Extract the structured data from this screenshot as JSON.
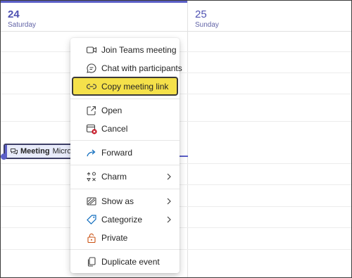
{
  "calendar": {
    "days": [
      {
        "number": "24",
        "name": "Saturday"
      },
      {
        "number": "25",
        "name": "Sunday"
      }
    ],
    "event": {
      "title": "Meeting",
      "organizer": "Microsof"
    }
  },
  "context_menu": {
    "items": [
      {
        "id": "join",
        "label": "Join Teams meeting",
        "icon": "video-camera-icon"
      },
      {
        "id": "chat",
        "label": "Chat with participants",
        "icon": "chat-icon"
      },
      {
        "id": "copylink",
        "label": "Copy meeting link",
        "icon": "link-icon",
        "highlighted": true
      },
      {
        "id": "open",
        "label": "Open",
        "icon": "open-icon"
      },
      {
        "id": "cancel",
        "label": "Cancel",
        "icon": "calendar-cancel-icon"
      },
      {
        "id": "forward",
        "label": "Forward",
        "icon": "forward-arrow-icon"
      },
      {
        "id": "charm",
        "label": "Charm",
        "icon": "charm-icon",
        "submenu": true
      },
      {
        "id": "showas",
        "label": "Show as",
        "icon": "show-as-icon",
        "submenu": true
      },
      {
        "id": "categorize",
        "label": "Categorize",
        "icon": "tag-icon",
        "submenu": true
      },
      {
        "id": "private",
        "label": "Private",
        "icon": "lock-icon"
      },
      {
        "id": "duplicate",
        "label": "Duplicate event",
        "icon": "copy-icon"
      }
    ]
  },
  "colors": {
    "accent": "#5b5fc7",
    "highlight": "#f5e14a",
    "cancel_badge": "#c50f1f",
    "forward_icon": "#0f6cbd"
  }
}
